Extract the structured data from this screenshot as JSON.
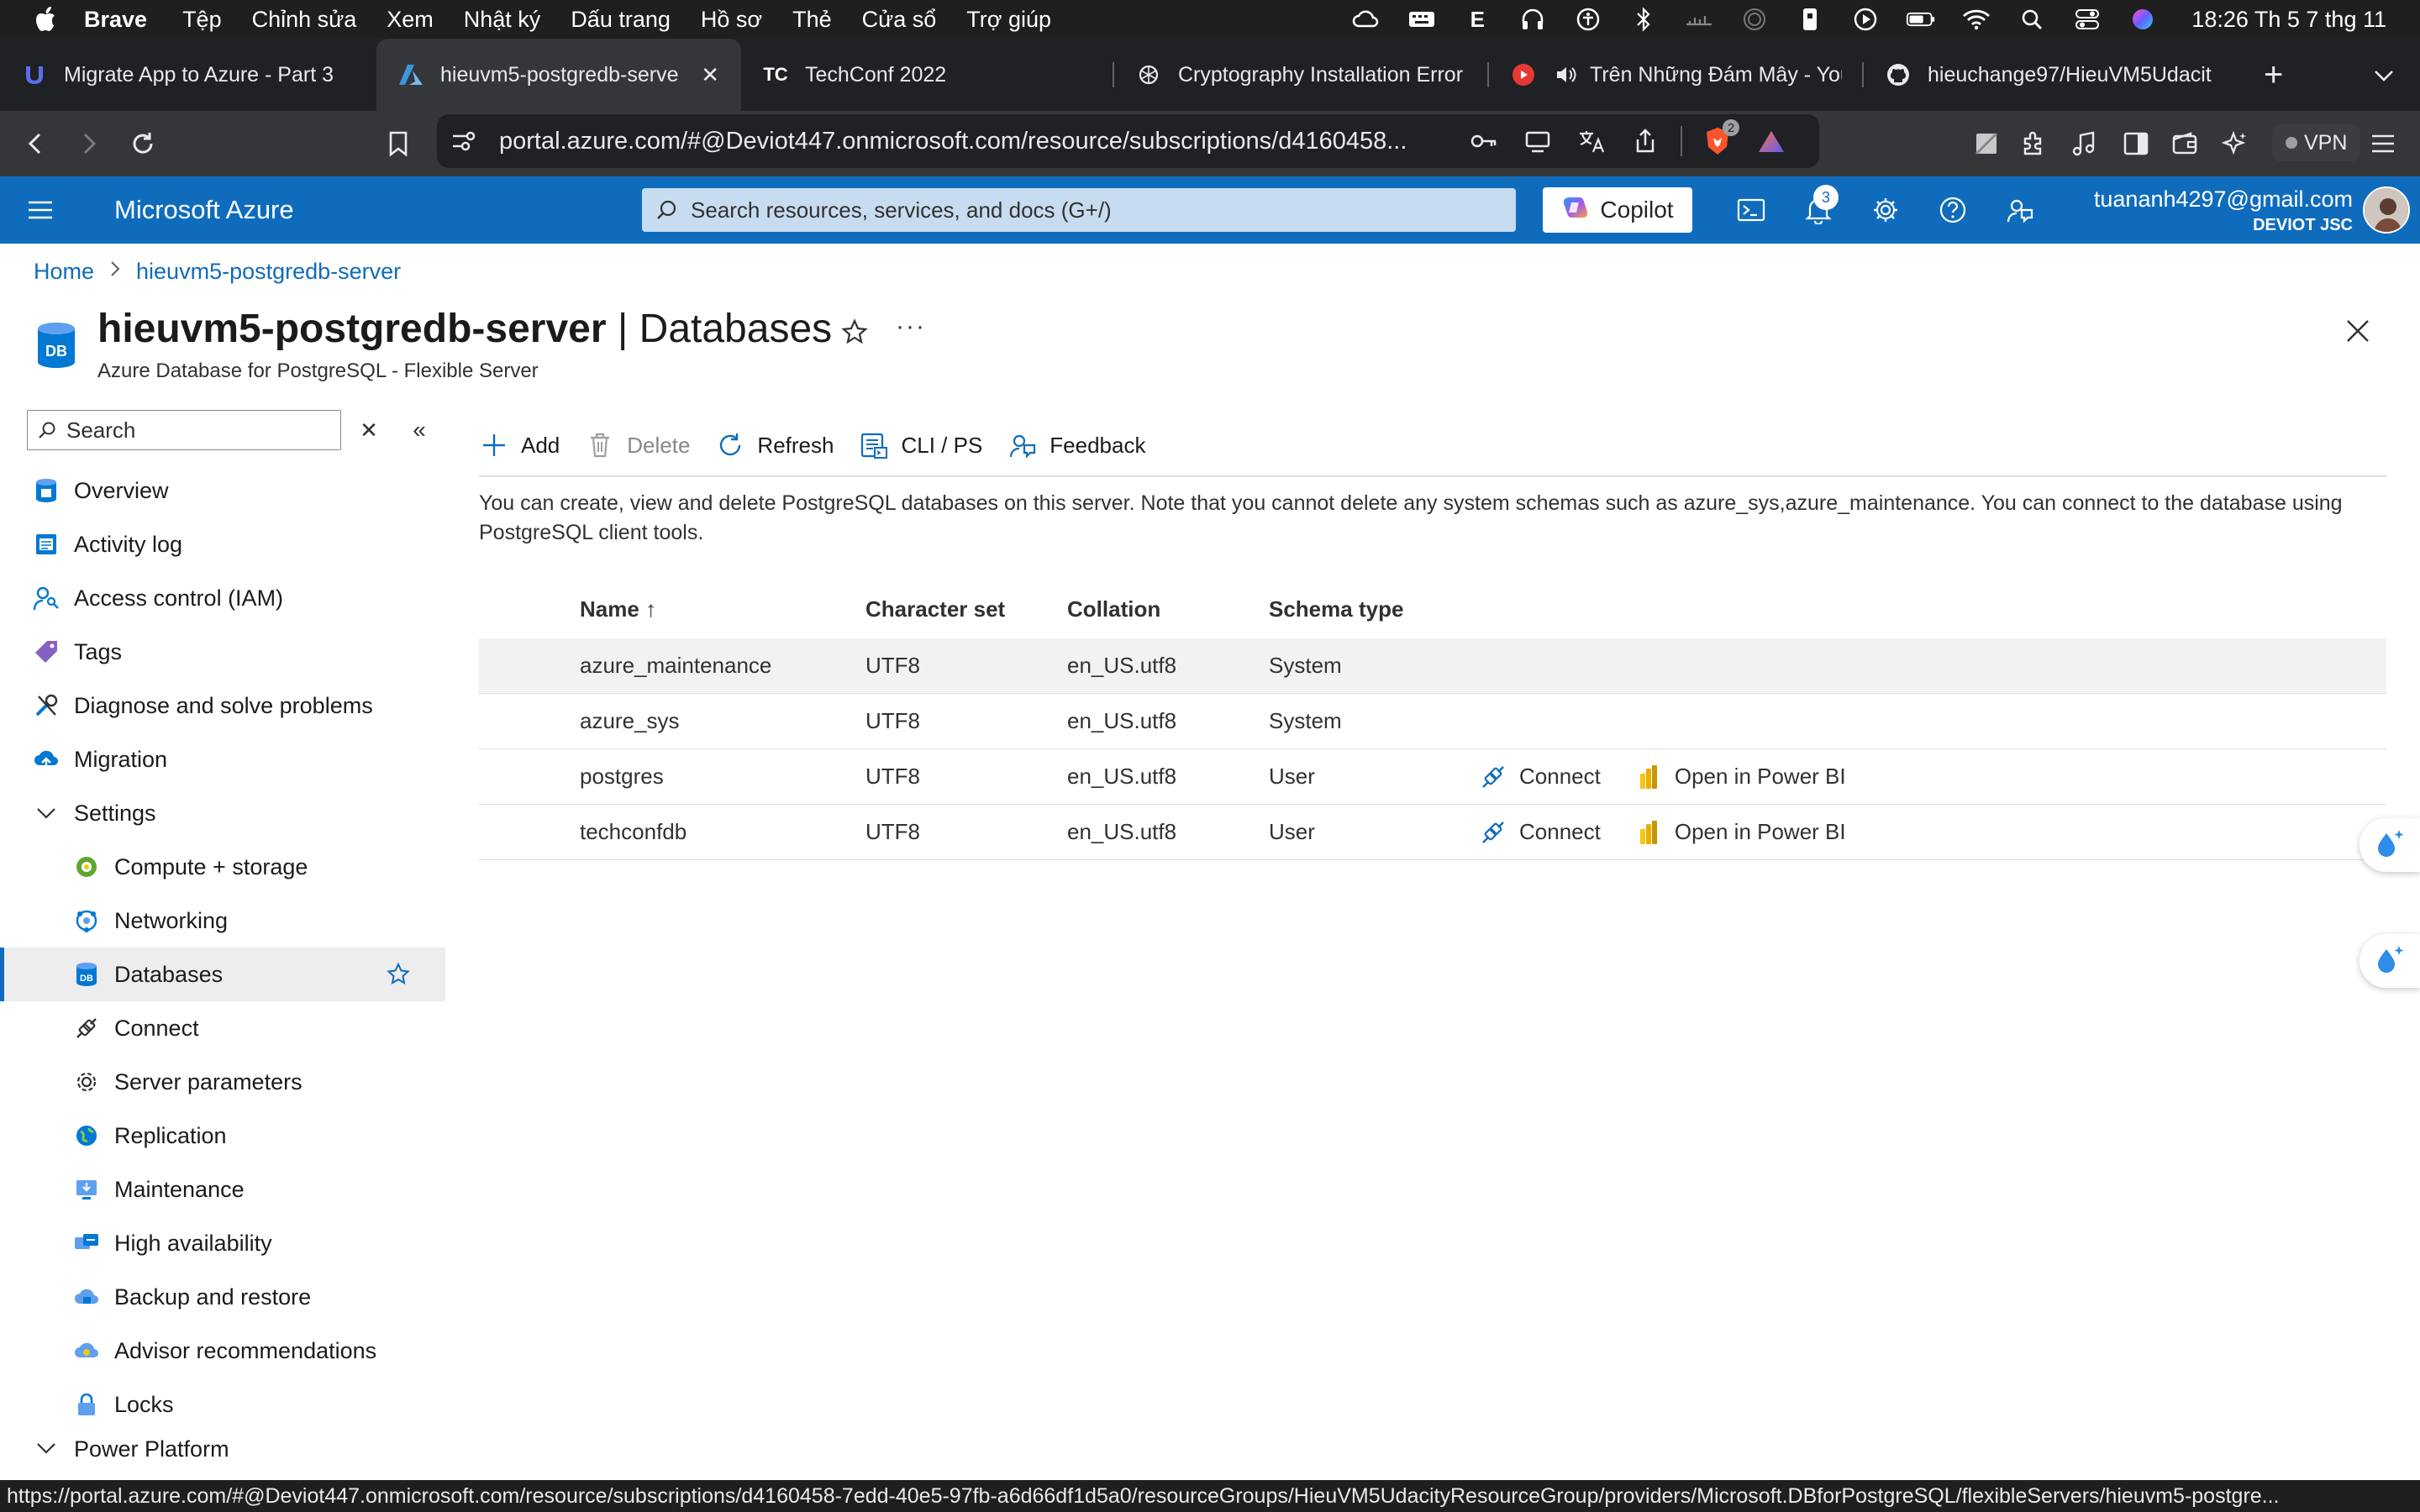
{
  "menubar": {
    "app": "Brave",
    "items": [
      "Tệp",
      "Chỉnh sửa",
      "Xem",
      "Nhật ký",
      "Dấu trang",
      "Hồ sơ",
      "Thẻ",
      "Cửa sổ",
      "Trợ giúp"
    ],
    "clock": "18:26 Th 5 7 thg 11"
  },
  "tabs": [
    {
      "title": "Migrate App to Azure - Part 3",
      "icon": "udacity-icon"
    },
    {
      "title": "hieuvm5-postgredb-serve",
      "icon": "azure-icon",
      "close": "✕"
    },
    {
      "title": "TechConf 2022",
      "icon": "techconf-icon"
    },
    {
      "title": "Cryptography Installation Error",
      "icon": "openai-icon"
    },
    {
      "title": "Trên Những Đám Mây - You",
      "icon": "youtube-icon"
    },
    {
      "title": "hieuchange97/HieuVM5Udacit",
      "icon": "github-icon"
    }
  ],
  "tabbar": {
    "new_tab": "+",
    "list": "⌄"
  },
  "address": {
    "url": "portal.azure.com/#@Deviot447.onmicrosoft.com/resource/subscriptions/d4160458...",
    "brave_badge": "2",
    "vpn": "VPN"
  },
  "azure": {
    "brand": "Microsoft Azure",
    "search_placeholder": "Search resources, services, and docs (G+/)",
    "copilot": "Copilot",
    "notifications": "3",
    "user_email": "tuananh4297@gmail.com",
    "user_org": "DEVIOT JSC"
  },
  "breadcrumb": {
    "home": "Home",
    "current": "hieuvm5-postgredb-server"
  },
  "page": {
    "resource": "hieuvm5-postgredb-server",
    "section": " | Databases",
    "subtitle": "Azure Database for PostgreSQL - Flexible Server",
    "more": "···"
  },
  "sidebar": {
    "search_placeholder": "Search",
    "clear": "✕",
    "collapse": "«",
    "items": [
      {
        "label": "Overview",
        "icon": "overview-icon"
      },
      {
        "label": "Activity log",
        "icon": "activity-log-icon"
      },
      {
        "label": "Access control (IAM)",
        "icon": "iam-icon"
      },
      {
        "label": "Tags",
        "icon": "tag-icon"
      },
      {
        "label": "Diagnose and solve problems",
        "icon": "wrench-icon"
      },
      {
        "label": "Migration",
        "icon": "migration-icon"
      },
      {
        "label": "Settings",
        "icon": "chevron-down-icon"
      },
      {
        "label": "Compute + storage",
        "icon": "compute-icon"
      },
      {
        "label": "Networking",
        "icon": "networking-icon"
      },
      {
        "label": "Databases",
        "icon": "database-icon"
      },
      {
        "label": "Connect",
        "icon": "connect-icon"
      },
      {
        "label": "Server parameters",
        "icon": "gear-icon"
      },
      {
        "label": "Replication",
        "icon": "globe-icon"
      },
      {
        "label": "Maintenance",
        "icon": "maintenance-icon"
      },
      {
        "label": "High availability",
        "icon": "high-availability-icon"
      },
      {
        "label": "Backup and restore",
        "icon": "cloud-backup-icon"
      },
      {
        "label": "Advisor recommendations",
        "icon": "advisor-icon"
      },
      {
        "label": "Locks",
        "icon": "lock-icon"
      },
      {
        "label": "Power Platform",
        "icon": "chevron-down-icon"
      }
    ]
  },
  "commands": {
    "add": "Add",
    "delete": "Delete",
    "refresh": "Refresh",
    "cli": "CLI / PS",
    "feedback": "Feedback"
  },
  "description": "You can create, view and delete PostgreSQL databases on this server. Note that you cannot delete any system schemas such as azure_sys,azure_maintenance. You can connect to the database using PostgreSQL client tools.",
  "table": {
    "headers": {
      "name": "Name",
      "sort": "↑",
      "charset": "Character set",
      "collation": "Collation",
      "schema": "Schema type"
    },
    "rows": [
      {
        "name": "azure_maintenance",
        "charset": "UTF8",
        "collation": "en_US.utf8",
        "schema": "System"
      },
      {
        "name": "azure_sys",
        "charset": "UTF8",
        "collation": "en_US.utf8",
        "schema": "System"
      },
      {
        "name": "postgres",
        "charset": "UTF8",
        "collation": "en_US.utf8",
        "schema": "User",
        "connect": "Connect",
        "powerbi": "Open in Power BI"
      },
      {
        "name": "techconfdb",
        "charset": "UTF8",
        "collation": "en_US.utf8",
        "schema": "User",
        "connect": "Connect",
        "powerbi": "Open in Power BI"
      }
    ]
  },
  "status_url": "https://portal.azure.com/#@Deviot447.onmicrosoft.com/resource/subscriptions/d4160458-7edd-40e5-97fb-a6d66df1d5a0/resourceGroups/HieuVM5UdacityResourceGroup/providers/Microsoft.DBforPostgreSQL/flexibleServers/hieuvm5-postgre...",
  "colors": {
    "azure_blue": "#0f6cbd",
    "menubar": "#1f1f1f",
    "selected_bg": "#ededed"
  }
}
